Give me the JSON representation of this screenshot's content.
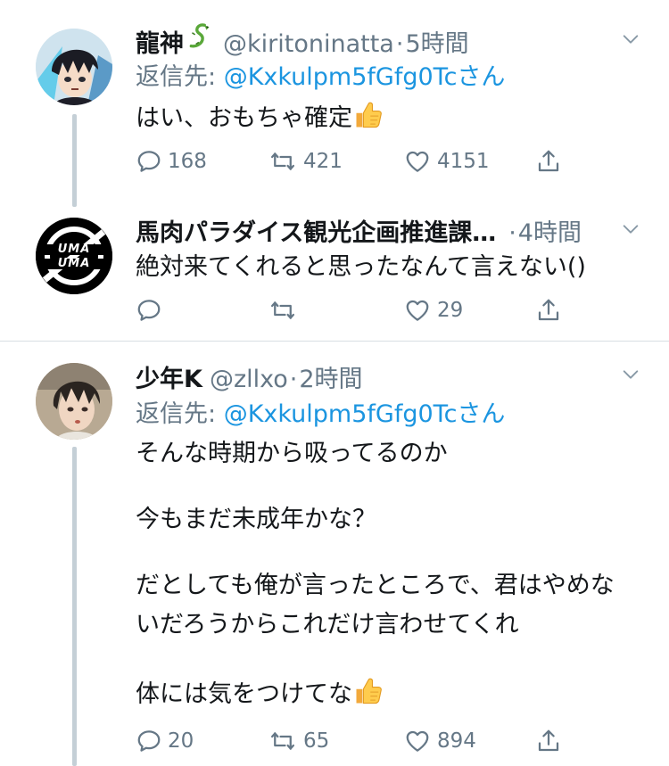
{
  "tweets": [
    {
      "name": "龍神",
      "handle": "@kiritoninatta",
      "dot": "·",
      "time": "5時間",
      "reply_label": "返信先: ",
      "reply_target": "@Kxkulpm5fGfg0Tcさん",
      "text": "はい、おもちゃ確定",
      "reply_count": "168",
      "retweet_count": "421",
      "like_count": "4151"
    },
    {
      "name": "馬肉パラダイス観光企画推進課…",
      "dot": "·",
      "time": "4時間",
      "text": "絶対来てくれると思ったなんて言えない()",
      "reply_count": "",
      "retweet_count": "",
      "like_count": "29",
      "avatar_text": "UMA UMA"
    },
    {
      "name": "少年K",
      "handle": "@zllxo",
      "dot": "·",
      "time": "2時間",
      "reply_label": "返信先: ",
      "reply_target": "@Kxkulpm5fGfg0Tcさん",
      "lines": [
        "そんな時期から吸ってるのか",
        "今もまだ未成年かな？",
        "だとしても俺が言ったところで、君はやめな",
        "いだろうからこれだけ言わせてくれ",
        "体には気をつけてな"
      ],
      "reply_count": "20",
      "retweet_count": "65",
      "like_count": "894"
    }
  ],
  "icons": [
    "reply-icon",
    "retweet-icon",
    "like-icon",
    "share-icon",
    "chevron-down-icon",
    "thumbs-up-emoji",
    "dragon-emoji"
  ],
  "colors": {
    "link": "#1b95e0",
    "secondary": "#657786",
    "text": "#14171a",
    "divider": "#d8dee3",
    "thread_line": "#c4cfd6"
  }
}
